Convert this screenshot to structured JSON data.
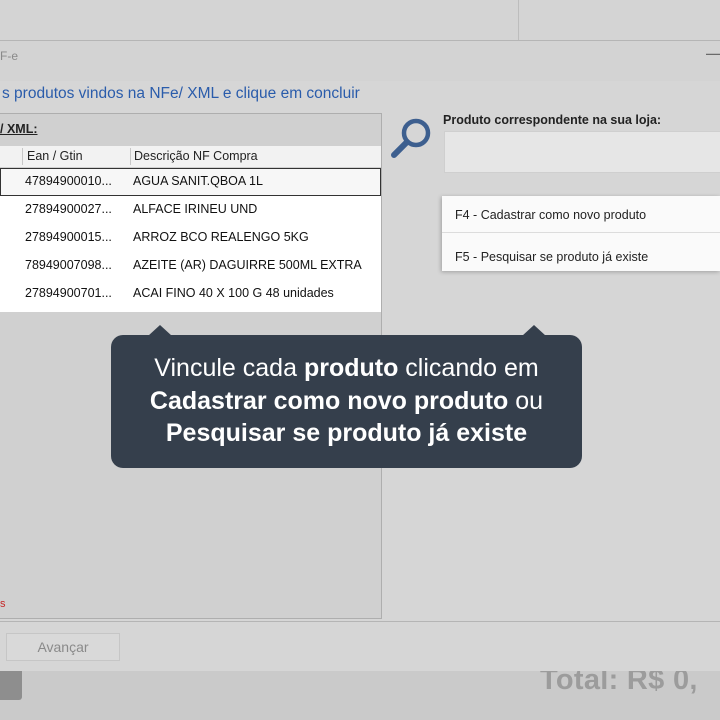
{
  "window": {
    "title_fragment": "F-e",
    "minimize_glyph": "—"
  },
  "instruction": "s produtos vindos na NFe/ XML e clique em concluir",
  "left_panel": {
    "label": "/ XML:",
    "columns": [
      "Ean / Gtin",
      "Descrição NF Compra"
    ],
    "rows": [
      {
        "ean": "47894900010...",
        "desc": "AGUA SANIT.QBOA 1L"
      },
      {
        "ean": "27894900027...",
        "desc": "ALFACE IRINEU UND"
      },
      {
        "ean": "27894900015...",
        "desc": "ARROZ BCO REALENGO 5KG"
      },
      {
        "ean": "78949007098...",
        "desc": "AZEITE (AR) DAGUIRRE 500ML EXTRA"
      },
      {
        "ean": "27894900701...",
        "desc": "ACAI FINO 40 X 100 G 48 unidades"
      }
    ],
    "selected_row": 0,
    "error_fragment": "s"
  },
  "right_panel": {
    "label": "Produto correspondente na sua loja:",
    "search_icon": "magnifier-icon",
    "menu": [
      "F4 - Cadastrar como novo produto",
      "F5 - Pesquisar se produto já existe"
    ]
  },
  "footer": {
    "next_button": "Avançar",
    "total": "Total:  R$ 0,"
  },
  "callout": {
    "part1": "Vincule cada ",
    "part2": "produto",
    "part3": " clicando em",
    "part4": "Cadastrar como novo produto",
    "part5": " ou",
    "part6": "Pesquisar se produto já existe"
  },
  "colors": {
    "accent_text": "#2a5cab",
    "callout_bg": "#353f4c",
    "error": "#c62828"
  }
}
